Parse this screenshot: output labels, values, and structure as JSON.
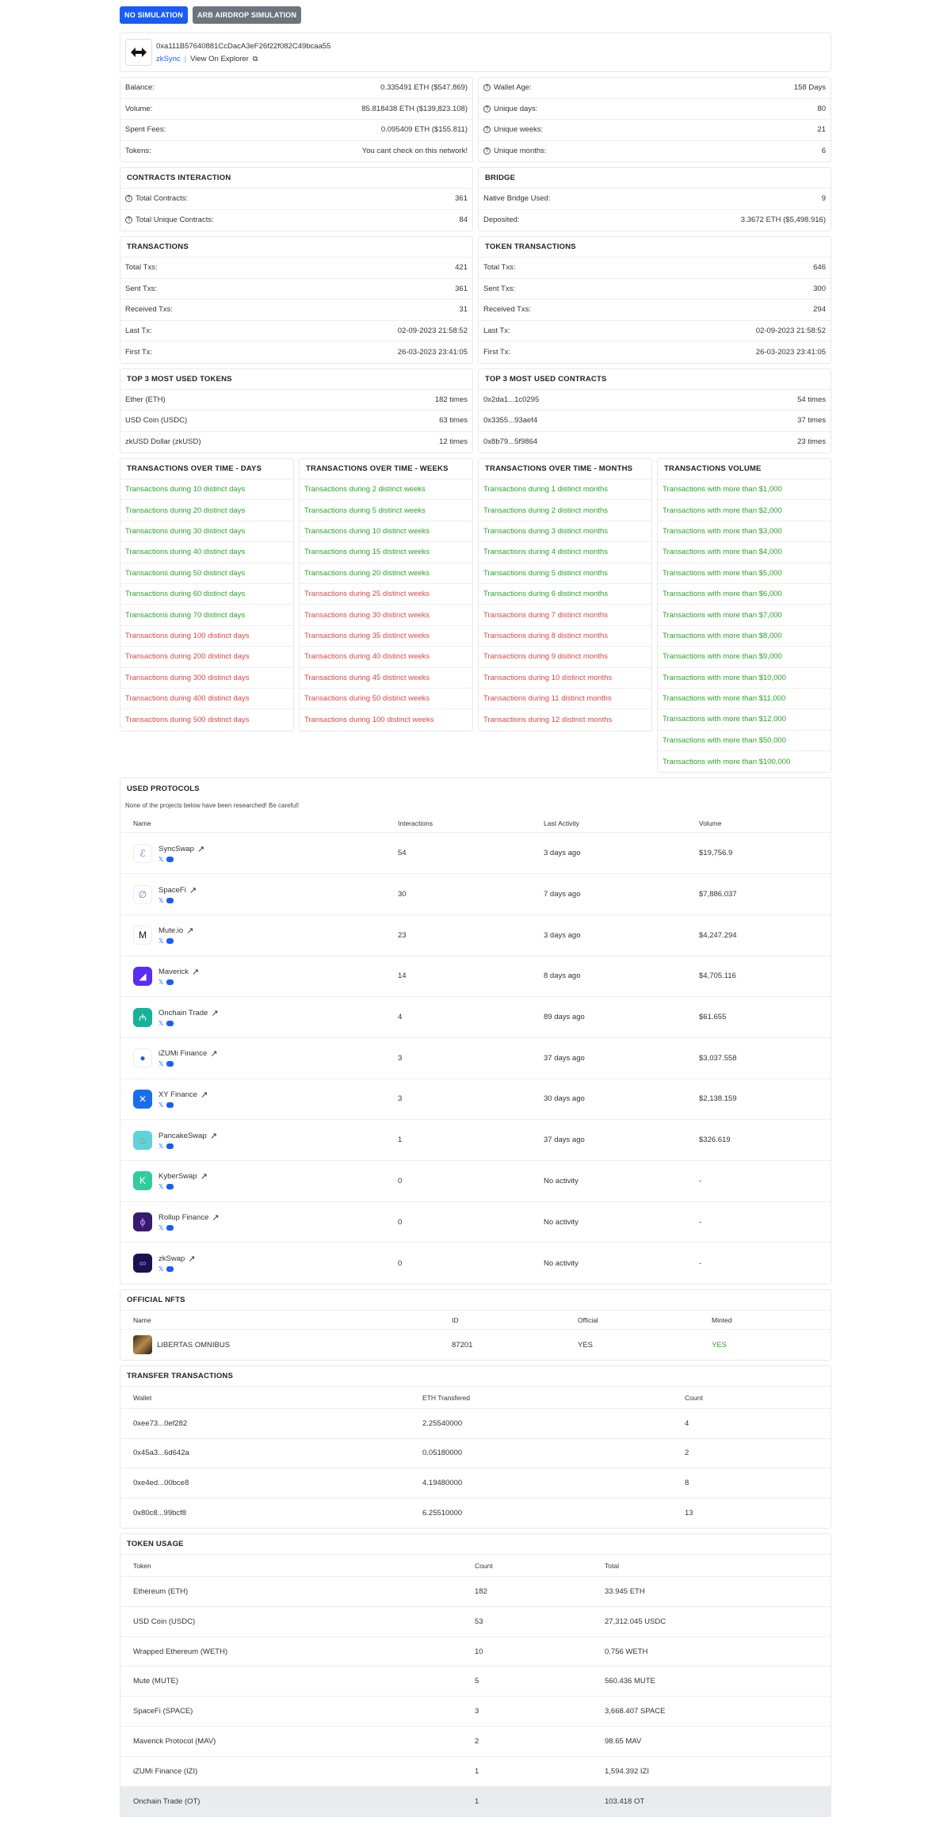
{
  "buttons": {
    "no_sim": "NO SIMULATION",
    "arb_sim": "ARB AIRDROP SIMULATION"
  },
  "address": {
    "hash": "0xa111B57640881CcDacA3eF26f22f082C49bcaa55",
    "network": "zkSync",
    "explorer": "View On Explorer"
  },
  "summary_left": [
    {
      "label": "Balance:",
      "value": "0.335491 ETH ($547.869)"
    },
    {
      "label": "Volume:",
      "value": "85.818438 ETH ($139,823.108)"
    },
    {
      "label": "Spent Fees:",
      "value": "0.095409 ETH ($155.811)"
    },
    {
      "label": "Tokens:",
      "value": "You cant check on this network!"
    }
  ],
  "summary_right": [
    {
      "label": "Wallet Age:",
      "value": "158 Days"
    },
    {
      "label": "Unique days:",
      "value": "80"
    },
    {
      "label": "Unique weeks:",
      "value": "21"
    },
    {
      "label": "Unique months:",
      "value": "6"
    }
  ],
  "contracts": {
    "title": "CONTRACTS INTERACTION",
    "rows": [
      {
        "label": "Total Contracts:",
        "value": "361"
      },
      {
        "label": "Total Unique Contracts:",
        "value": "84"
      }
    ]
  },
  "bridge": {
    "title": "BRIDGE",
    "rows": [
      {
        "label": "Native Bridge Used:",
        "value": "9"
      },
      {
        "label": "Deposited:",
        "value": "3.3672 ETH ($5,498.916)"
      }
    ]
  },
  "transactions": {
    "title": "TRANSACTIONS",
    "rows": [
      {
        "label": "Total Txs:",
        "value": "421"
      },
      {
        "label": "Sent Txs:",
        "value": "361"
      },
      {
        "label": "Received Txs:",
        "value": "31"
      },
      {
        "label": "Last Tx:",
        "value": "02-09-2023 21:58:52"
      },
      {
        "label": "First Tx:",
        "value": "26-03-2023 23:41:05"
      }
    ]
  },
  "token_transactions": {
    "title": "TOKEN TRANSACTIONS",
    "rows": [
      {
        "label": "Total Txs:",
        "value": "646"
      },
      {
        "label": "Sent Txs:",
        "value": "300"
      },
      {
        "label": "Received Txs:",
        "value": "294"
      },
      {
        "label": "Last Tx:",
        "value": "02-09-2023 21:58:52"
      },
      {
        "label": "First Tx:",
        "value": "26-03-2023 23:41:05"
      }
    ]
  },
  "top_tokens": {
    "title": "TOP 3 MOST USED TOKENS",
    "rows": [
      {
        "label": "Ether (ETH)",
        "value": "182 times"
      },
      {
        "label": "USD Coin (USDC)",
        "value": "63 times"
      },
      {
        "label": "zkUSD Dollar (zkUSD)",
        "value": "12 times"
      }
    ]
  },
  "top_contracts": {
    "title": "TOP 3 MOST USED CONTRACTS",
    "rows": [
      {
        "label": "0x2da1...1c0295",
        "value": "54 times"
      },
      {
        "label": "0x3355...93aef4",
        "value": "37 times"
      },
      {
        "label": "0x8b79...5f9864",
        "value": "23 times"
      }
    ]
  },
  "over_days": {
    "title": "TRANSACTIONS OVER TIME - DAYS",
    "items": [
      {
        "text": "Transactions during 10 distinct days",
        "ok": true
      },
      {
        "text": "Transactions during 20 distinct days",
        "ok": true
      },
      {
        "text": "Transactions during 30 distinct days",
        "ok": true
      },
      {
        "text": "Transactions during 40 distinct days",
        "ok": true
      },
      {
        "text": "Transactions during 50 distinct days",
        "ok": true
      },
      {
        "text": "Transactions during 60 distinct days",
        "ok": true
      },
      {
        "text": "Transactions during 70 distinct days",
        "ok": true
      },
      {
        "text": "Transactions during 100 distinct days",
        "ok": false
      },
      {
        "text": "Transactions during 200 distinct days",
        "ok": false
      },
      {
        "text": "Transactions during 300 distinct days",
        "ok": false
      },
      {
        "text": "Transactions during 400 distinct days",
        "ok": false
      },
      {
        "text": "Transactions during 500 distinct days",
        "ok": false
      }
    ]
  },
  "over_weeks": {
    "title": "TRANSACTIONS OVER TIME - WEEKS",
    "items": [
      {
        "text": "Transactions during 2 distinct weeks",
        "ok": true
      },
      {
        "text": "Transactions during 5 distinct weeks",
        "ok": true
      },
      {
        "text": "Transactions during 10 distinct weeks",
        "ok": true
      },
      {
        "text": "Transactions during 15 distinct weeks",
        "ok": true
      },
      {
        "text": "Transactions during 20 distinct weeks",
        "ok": true
      },
      {
        "text": "Transactions during 25 distinct weeks",
        "ok": false
      },
      {
        "text": "Transactions during 30 distinct weeks",
        "ok": false
      },
      {
        "text": "Transactions during 35 distinct weeks",
        "ok": false
      },
      {
        "text": "Transactions during 40 distinct weeks",
        "ok": false
      },
      {
        "text": "Transactions during 45 distinct weeks",
        "ok": false
      },
      {
        "text": "Transactions during 50 distinct weeks",
        "ok": false
      },
      {
        "text": "Transactions during 100 distinct weeks",
        "ok": false
      }
    ]
  },
  "over_months": {
    "title": "TRANSACTIONS OVER TIME - MONTHS",
    "items": [
      {
        "text": "Transactions during 1 distinct months",
        "ok": true
      },
      {
        "text": "Transactions during 2 distinct months",
        "ok": true
      },
      {
        "text": "Transactions during 3 distinct months",
        "ok": true
      },
      {
        "text": "Transactions during 4 distinct months",
        "ok": true
      },
      {
        "text": "Transactions during 5 distinct months",
        "ok": true
      },
      {
        "text": "Transactions during 6 distinct months",
        "ok": true
      },
      {
        "text": "Transactions during 7 distinct months",
        "ok": false
      },
      {
        "text": "Transactions during 8 distinct months",
        "ok": false
      },
      {
        "text": "Transactions during 9 distinct months",
        "ok": false
      },
      {
        "text": "Transactions during 10 distinct months",
        "ok": false
      },
      {
        "text": "Transactions during 11 distinct months",
        "ok": false
      },
      {
        "text": "Transactions during 12 distinct months",
        "ok": false
      }
    ]
  },
  "volume": {
    "title": "TRANSACTIONS VOLUME",
    "items": [
      {
        "text": "Transactions with more than $1,000",
        "ok": true
      },
      {
        "text": "Transactions with more than $2,000",
        "ok": true
      },
      {
        "text": "Transactions with more than $3,000",
        "ok": true
      },
      {
        "text": "Transactions with more than $4,000",
        "ok": true
      },
      {
        "text": "Transactions with more than $5,000",
        "ok": true
      },
      {
        "text": "Transactions with more than $6,000",
        "ok": true
      },
      {
        "text": "Transactions with more than $7,000",
        "ok": true
      },
      {
        "text": "Transactions with more than $8,000",
        "ok": true
      },
      {
        "text": "Transactions with more than $9,000",
        "ok": true
      },
      {
        "text": "Transactions with more than $10,000",
        "ok": true
      },
      {
        "text": "Transactions with more than $11,000",
        "ok": true
      },
      {
        "text": "Transactions with more than $12,000",
        "ok": true
      },
      {
        "text": "Transactions with more than $50,000",
        "ok": true
      },
      {
        "text": "Transactions with more than $100,000",
        "ok": true
      }
    ]
  },
  "protocols": {
    "title": "USED PROTOCOLS",
    "note": "None of the projects below have been researched! Be careful!",
    "headers": [
      "Name",
      "Interactions",
      "Last Activity",
      "Volume"
    ],
    "rows": [
      {
        "name": "SyncSwap",
        "icon": "syncswap-logo-icon",
        "bg": "#ffffff",
        "glyph": "ℰ",
        "fg": "#8a5cf6",
        "interactions": "54",
        "last": "3 days ago",
        "volume": "$19,756.9"
      },
      {
        "name": "SpaceFi",
        "icon": "spacefi-logo-icon",
        "bg": "#ffffff",
        "glyph": "∅",
        "fg": "#9b59f5",
        "interactions": "30",
        "last": "7 days ago",
        "volume": "$7,886.037"
      },
      {
        "name": "Mute.io",
        "icon": "muteio-logo-icon",
        "bg": "#ffffff",
        "glyph": "M",
        "fg": "#111111",
        "interactions": "23",
        "last": "3 days ago",
        "volume": "$4,247.294"
      },
      {
        "name": "Maverick",
        "icon": "maverick-logo-icon",
        "bg": "#5b2cf5",
        "glyph": "◢",
        "fg": "#ffffff",
        "interactions": "14",
        "last": "8 days ago",
        "volume": "$4,705.116"
      },
      {
        "name": "Onchain Trade",
        "icon": "onchain-trade-logo-icon",
        "bg": "#14b39a",
        "glyph": "₼",
        "fg": "#ffffff",
        "interactions": "4",
        "last": "89 days ago",
        "volume": "$61.655"
      },
      {
        "name": "iZUMi Finance",
        "icon": "izumi-logo-icon",
        "bg": "#ffffff",
        "glyph": "●",
        "fg": "#2a5ce6",
        "interactions": "3",
        "last": "37 days ago",
        "volume": "$3,037.558"
      },
      {
        "name": "XY Finance",
        "icon": "xy-finance-logo-icon",
        "bg": "#1a6df0",
        "glyph": "✕",
        "fg": "#ffffff",
        "interactions": "3",
        "last": "30 days ago",
        "volume": "$2,138.159"
      },
      {
        "name": "PancakeSwap",
        "icon": "pancakeswap-logo-icon",
        "bg": "#5fd3db",
        "glyph": "♨",
        "fg": "#c47a2a",
        "interactions": "1",
        "last": "37 days ago",
        "volume": "$326.619"
      },
      {
        "name": "KyberSwap",
        "icon": "kyberswap-logo-icon",
        "bg": "#31cb9e",
        "glyph": "K",
        "fg": "#ffffff",
        "interactions": "0",
        "last": "No activity",
        "volume": "-"
      },
      {
        "name": "Rollup Finance",
        "icon": "rollup-finance-logo-icon",
        "bg": "#3a1a6e",
        "glyph": "ϕ",
        "fg": "#c49bff",
        "interactions": "0",
        "last": "No activity",
        "volume": "-"
      },
      {
        "name": "zkSwap",
        "icon": "zkswap-logo-icon",
        "bg": "#1b1350",
        "glyph": "∞",
        "fg": "#b67cff",
        "interactions": "0",
        "last": "No activity",
        "volume": "-"
      }
    ]
  },
  "nfts": {
    "title": "OFFICIAL NFTS",
    "headers": [
      "Name",
      "ID",
      "Official",
      "Minted"
    ],
    "rows": [
      {
        "name": "LIBERTAS OMNIBUS",
        "id": "87201",
        "official": "YES",
        "minted": "YES"
      }
    ]
  },
  "transfers": {
    "title": "TRANSFER TRANSACTIONS",
    "headers": [
      "Wallet",
      "ETH Transfered",
      "Count"
    ],
    "rows": [
      {
        "wallet": "0xee73...0ef282",
        "eth": "2.25540000",
        "count": "4"
      },
      {
        "wallet": "0x45a3...6d642a",
        "eth": "0.05180000",
        "count": "2"
      },
      {
        "wallet": "0xe4ed...00bce8",
        "eth": "4.19480000",
        "count": "8"
      },
      {
        "wallet": "0x80c8...99bcf8",
        "eth": "6.25510000",
        "count": "13"
      }
    ]
  },
  "token_usage": {
    "title": "TOKEN USAGE",
    "headers": [
      "Token",
      "Count",
      "Total"
    ],
    "rows": [
      {
        "token": "Ethereum (ETH)",
        "count": "182",
        "total": "33.945 ETH"
      },
      {
        "token": "USD Coin (USDC)",
        "count": "53",
        "total": "27,312.045 USDC"
      },
      {
        "token": "Wrapped Ethereum (WETH)",
        "count": "10",
        "total": "0.756 WETH"
      },
      {
        "token": "Mute (MUTE)",
        "count": "5",
        "total": "560.436 MUTE"
      },
      {
        "token": "SpaceFi (SPACE)",
        "count": "3",
        "total": "3,668.407 SPACE"
      },
      {
        "token": "Maverick Protocol (MAV)",
        "count": "2",
        "total": "98.65 MAV"
      },
      {
        "token": "iZUMi Finance (IZI)",
        "count": "1",
        "total": "1,594.392 IZI"
      },
      {
        "token": "Onchain Trade (OT)",
        "count": "1",
        "total": "103.418 OT"
      }
    ]
  },
  "colors": {
    "primary": "#1a5df6",
    "ok": "#2aa52a",
    "fail": "#e24545",
    "highlight_row": "#e9ecef"
  }
}
